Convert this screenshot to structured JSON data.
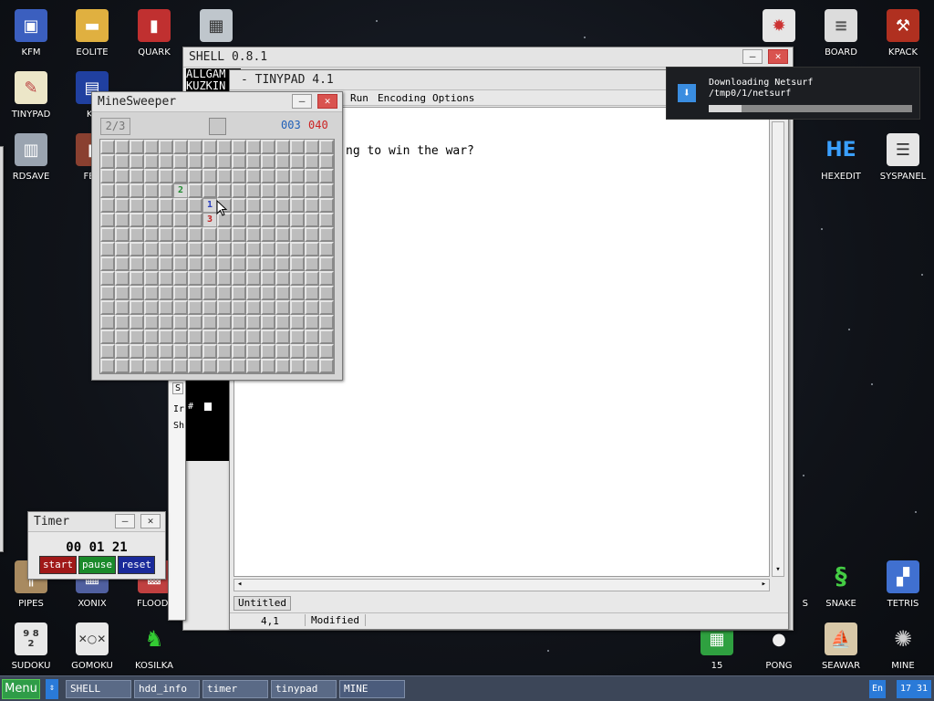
{
  "desktop_icons": {
    "kfm": "KFM",
    "eolite": "EOLITE",
    "quark": "QUARK",
    "board": "BOARD",
    "kpack": "KPACK",
    "tinypad": "TINYPAD",
    "kf": "KF",
    "rdsave": "RDSAVE",
    "fb2": "FB2",
    "hexedit": "HEXEDIT",
    "syspanel": "SYSPANEL",
    "pipes": "PIPES",
    "xonix": "XONIX",
    "flood": "FLOOD-",
    "s": "S",
    "snake": "SNAKE",
    "tetris": "TETRIS",
    "sudoku": "SUDOKU",
    "gomoku": "GOMOKU",
    "kosilka": "KOSILKA",
    "fifteen": "15",
    "pong": "PONG",
    "seawar": "SEAWAR",
    "mine": "MINE"
  },
  "shell": {
    "title": "SHELL 0.8.1",
    "text_line1": "ALLGAM",
    "text_line2": "KUZKIN",
    "side_s": "S",
    "side_ir": "Ir",
    "side_sh": "Sh",
    "prompt": "#"
  },
  "tinypad": {
    "title": "- TINYPAD 4.1",
    "menu": {
      "run": "Run",
      "encoding": "Encoding",
      "options": "Options"
    },
    "text": "ng to win the war?",
    "tab": "Untitled",
    "status_pos": "4,1",
    "status_mod": "Modified"
  },
  "minesweeper": {
    "title": "MineSweeper",
    "level": "2/3",
    "mines": "003",
    "time": "040",
    "rows": 16,
    "cols": 16,
    "open_cells": [
      {
        "r": 3,
        "c": 5,
        "v": "2"
      },
      {
        "r": 4,
        "c": 7,
        "v": "1"
      },
      {
        "r": 5,
        "c": 7,
        "v": "3"
      }
    ]
  },
  "timer": {
    "title": "Timer",
    "time": "00 01 21",
    "start": "start",
    "pause": "pause",
    "reset": "reset"
  },
  "notification": {
    "title": "Downloading Netsurf",
    "path": "/tmp0/1/netsurf",
    "progress": 0.16
  },
  "taskbar": {
    "menu": "Menu",
    "tasks": [
      "SHELL",
      "hdd_info",
      "timer",
      "tinypad",
      "MINE"
    ],
    "lang": "En",
    "clock": "17 31"
  },
  "colors": {
    "taskbar": "#3c4658",
    "menu_button": "#2f9c48",
    "close": "#d9534f"
  }
}
